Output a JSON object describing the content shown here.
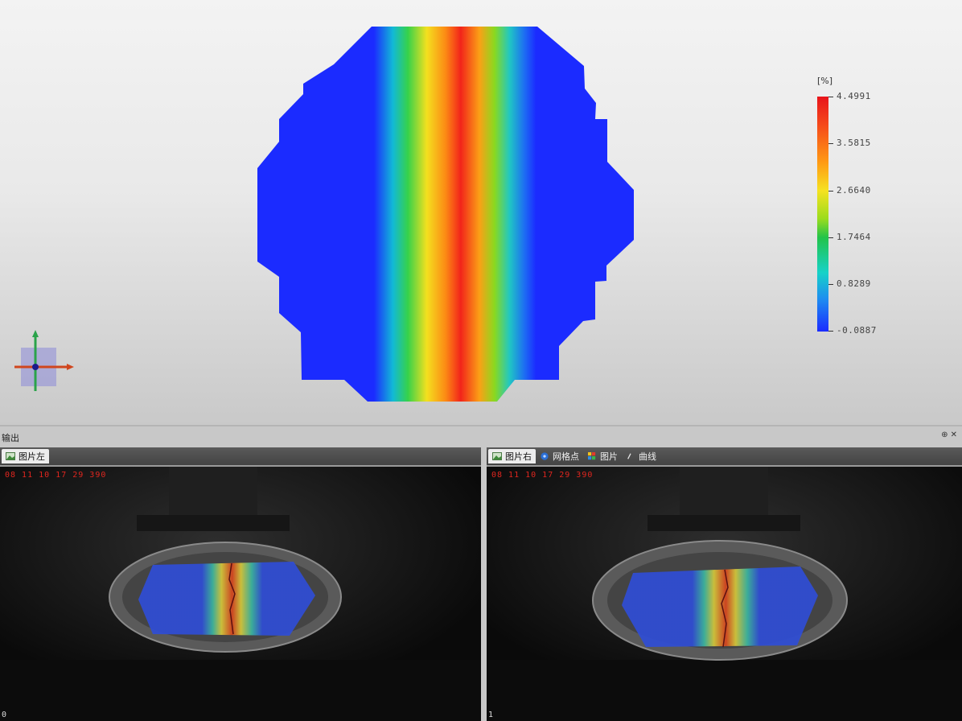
{
  "viewport": {
    "colorbar": {
      "unit": "[%]",
      "labels": [
        "4.4991",
        "3.5815",
        "2.6640",
        "1.7464",
        "0.8289",
        "-0.0887"
      ]
    }
  },
  "bottom_panel": {
    "title": "输出",
    "controls": "⊕ ✕",
    "left_pane": {
      "tabs": [
        {
          "label": "图片左",
          "icon": "image-icon"
        }
      ],
      "timestamp": "08 11 10 17 29 390",
      "frame": "0"
    },
    "right_pane": {
      "tabs": [
        {
          "label": "图片右",
          "icon": "image-icon"
        },
        {
          "label": "网格点",
          "icon": "grid-icon"
        },
        {
          "label": "图片",
          "icon": "tiles-icon"
        },
        {
          "label": "曲线",
          "icon": "curve-icon"
        }
      ],
      "timestamp": "08 11 10 17 29 390",
      "frame": "1"
    }
  },
  "colors": {
    "strain_high": "#e8141b",
    "strain_low": "#1b2bff",
    "timestamp": "#e0261f"
  }
}
